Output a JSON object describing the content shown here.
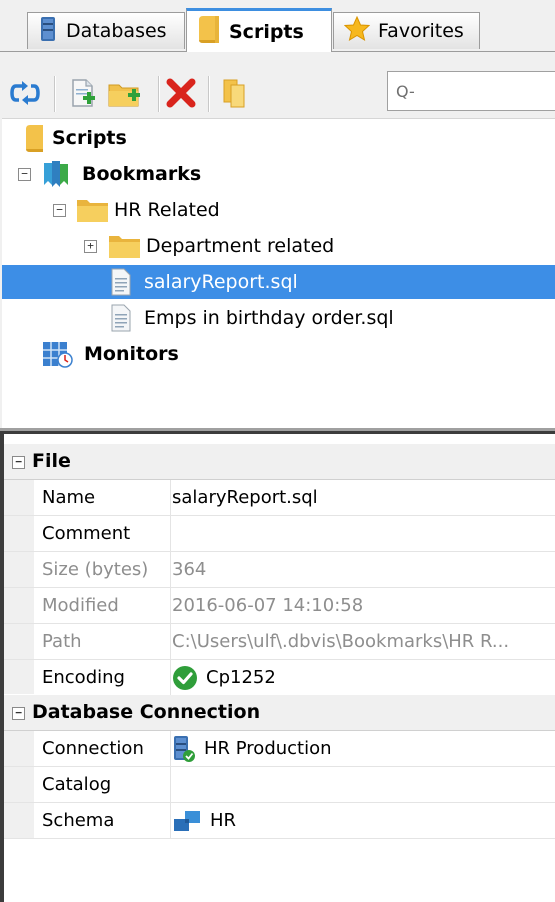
{
  "tabs": [
    {
      "label": "Databases",
      "icon": "database-icon",
      "active": false
    },
    {
      "label": "Scripts",
      "icon": "scripts-folder-icon",
      "active": true
    },
    {
      "label": "Favorites",
      "icon": "star-icon",
      "active": false
    }
  ],
  "toolbar": {
    "buttons": [
      {
        "name": "refresh-button",
        "icon": "refresh-icon"
      },
      {
        "name": "new-script-button",
        "icon": "new-file-icon"
      },
      {
        "name": "new-folder-button",
        "icon": "new-folder-icon"
      },
      {
        "name": "delete-button",
        "icon": "delete-icon"
      },
      {
        "name": "copy-button",
        "icon": "copy-icon"
      }
    ],
    "search_glyph": "Q-"
  },
  "tree": {
    "root_label": "Scripts",
    "bookmarks_label": "Bookmarks",
    "hr_folder_label": "HR Related",
    "dept_folder_label": "Department related",
    "file1_label": "salaryReport.sql",
    "file2_label": "Emps in birthday order.sql",
    "monitors_label": "Monitors",
    "selected": "salaryReport.sql"
  },
  "properties": {
    "file_section": "File",
    "file_rows": [
      {
        "key": "Name",
        "value": "salaryReport.sql",
        "readonly": false
      },
      {
        "key": "Comment",
        "value": "",
        "readonly": false
      },
      {
        "key": "Size (bytes)",
        "value": "364",
        "readonly": true
      },
      {
        "key": "Modified",
        "value": "2016-06-07 14:10:58",
        "readonly": true
      },
      {
        "key": "Path",
        "value": "C:\\Users\\ulf\\.dbvis\\Bookmarks\\HR R...",
        "readonly": true
      },
      {
        "key": "Encoding",
        "value": "Cp1252",
        "readonly": false,
        "icon": "check-circle-icon"
      }
    ],
    "db_section": "Database Connection",
    "db_rows": [
      {
        "key": "Connection",
        "value": "HR Production",
        "icon": "connection-icon"
      },
      {
        "key": "Catalog",
        "value": ""
      },
      {
        "key": "Schema",
        "value": "HR",
        "icon": "schema-icon"
      }
    ]
  },
  "colors": {
    "selection": "#3d8ee6",
    "active_tab_accent": "#3d8ee0",
    "check_green": "#2f9e3a",
    "delete_red": "#d9241c"
  }
}
